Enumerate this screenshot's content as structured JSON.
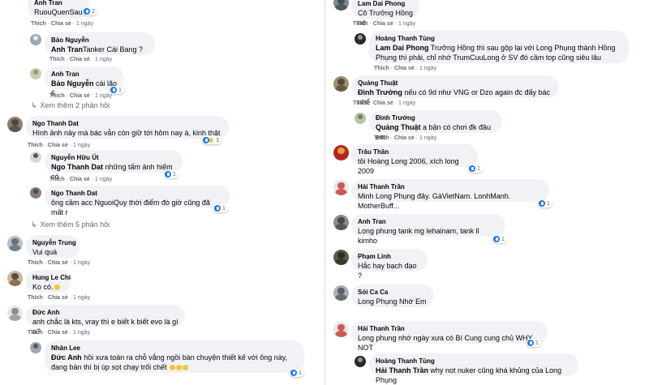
{
  "actions": {
    "like": "Thích",
    "share": "Chia sẻ",
    "time": "1 ngày",
    "sep": "·"
  },
  "left": [
    {
      "name": "Anh Tran",
      "text": "RuouQuenSau",
      "reacts": "2"
    },
    {
      "name": "Bảo Nguyễn",
      "tag": "Anh Tran",
      "text": "Tanker Cái Bang ?"
    },
    {
      "name": "Anh Tran",
      "tag": "Bảo Nguyễn",
      "text": " cái lão 6",
      "reacts": "1"
    },
    {
      "more": "Xem thêm 2 phản hồi"
    },
    {
      "name": "Ngo Thanh Dat",
      "text": "Hình ảnh này mà bác vẫn còn giữ tới hôm nay à, kinh thật",
      "reacts": "3"
    },
    {
      "name": "Nguyễn Hữu Út",
      "tag": "Ngo Thanh Dat",
      "text": " những tấm ảnh hiếm có",
      "reacts": "1"
    },
    {
      "name": "Ngo Thanh Dat",
      "text": "ông cầm acc NguoiQuy thời điểm đó giờ cũng đã mất r",
      "reacts": "1"
    },
    {
      "more": "Xem thêm 5 phản hồi"
    },
    {
      "name": "Nguyễn Trung",
      "text": "Vui quá"
    },
    {
      "name": "Hung Le Chi",
      "text": "Ko có."
    },
    {
      "name": "Đức Anh",
      "text": "anh chắc là kts, vray thì e biết k biết evo là gì a?"
    },
    {
      "name": "Nhân Lee",
      "tag": "Đức Anh",
      "text": " hồi xưa toàn ra chỗ vắng ngồi bàn chuyện thiết kế với ông này, đang bàn thì bị úp sọt chạy trối chết",
      "reacts": "1"
    }
  ],
  "right": [
    {
      "name": "Lam Dai Phong",
      "text": "Cô Trưởng Hồng nè"
    },
    {
      "name": "Hoàng Thanh Tùng",
      "tag": "Lam Dai Phong",
      "text": " Trưởng Hồng thì sau gộp lại với Long Phụng thành Hồng Phụng thì phải, chỉ nhớ TrumCuuLong ở SV đó cầm top cũng siêu lâu"
    },
    {
      "name": "Quảng Thuật",
      "tag": "Đình Trưởng",
      "text": " nếu có 9d như VNG or Dzo again đc đấy bác nhể"
    },
    {
      "name": "Đình Trưởng",
      "tag": "Quảng Thuật",
      "text": " a bận có chơi đk đâu em"
    },
    {
      "name": "Trâu Thần",
      "text": "tôi Hoàng Long 2006, xích long 2009",
      "reacts": "1"
    },
    {
      "name": "Hải Thanh Trần",
      "text": "Minh Long Phụng đây. GàVietNam. LonhManh. MotherBuff...",
      "reacts": "1"
    },
    {
      "name": "Anh Tran",
      "text": "Long phung tank mg lehainam, tank ll kimho",
      "reacts": "1"
    },
    {
      "name": "Phạm Linh",
      "text": "Hắc hay bạch đạo ?"
    },
    {
      "name": "Sói Ca Ca",
      "text": "Long Phụng Nhớ Em"
    },
    {
      "name": "Hải Thanh Trần",
      "text": "Long phung nhớ ngày xưa có Bí Cung cung chủ WHY NOT",
      "reacts": "1"
    },
    {
      "name": "Hoàng Thanh Tùng",
      "tag": "Hải Thanh Trần",
      "text": " why not nuker cũng khá khủng của Long Phụng"
    }
  ],
  "colors": {
    "bubble": "#f0f2f5",
    "accent": "#1877f2",
    "muted": "#65676b"
  }
}
